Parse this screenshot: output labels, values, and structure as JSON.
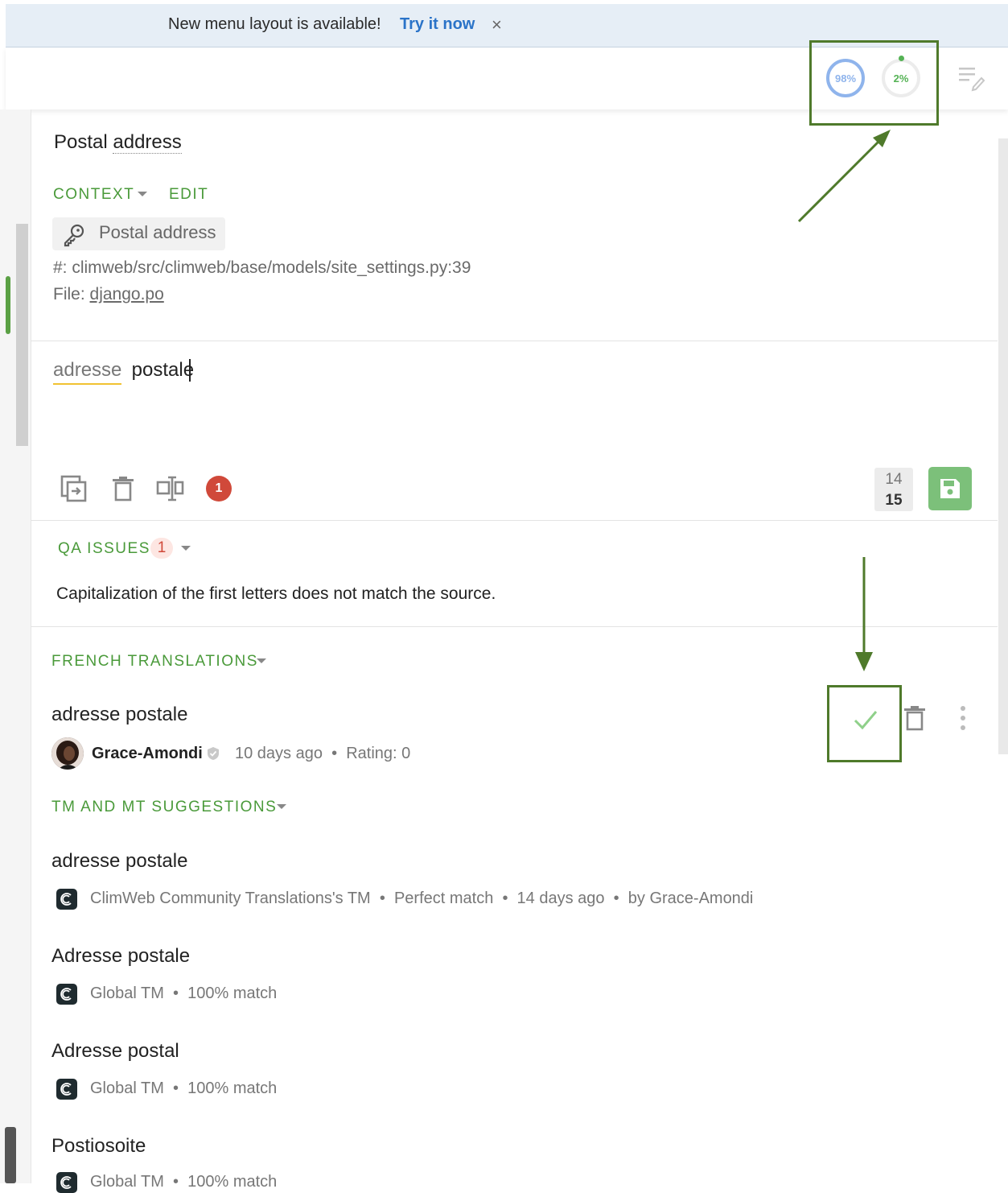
{
  "banner": {
    "text": "New menu layout is available!",
    "link": "Try it now",
    "close": "×"
  },
  "progress": {
    "approved_pct_label": "98%",
    "approved_fraction": 0.98,
    "pending_pct_label": "2%",
    "pending_fraction": 0.02
  },
  "colors": {
    "accent_green": "#4a9a3a",
    "approved_blue": "#8fb4ec",
    "warning_red": "#d0493a",
    "save_green": "#7cc07a",
    "highlight_box": "#4f7a2b"
  },
  "source": {
    "title_prefix": "Postal ",
    "title_underlined": "address",
    "context_label": "CONTEXT",
    "edit_label": "EDIT",
    "key": "Postal address",
    "path": "#: climweb/src/climweb/base/models/site_settings.py:39",
    "file_prefix": "File: ",
    "file_name": "django.po"
  },
  "editor": {
    "word1": "adresse",
    "word2": " postale",
    "warning_count": "1",
    "original_count": "14",
    "translation_count": "15"
  },
  "qa": {
    "label": "QA ISSUES",
    "count": "1",
    "message": "Capitalization of the first letters does not match the source."
  },
  "french": {
    "label": "FRENCH TRANSLATIONS",
    "text": "adresse postale",
    "author": "Grace-Amondi",
    "meta": "10 days ago  •  Rating: 0"
  },
  "suggestions": {
    "label": "TM AND MT SUGGESTIONS",
    "items": [
      {
        "text": "adresse postale",
        "meta": "ClimWeb Community Translations's TM  •  Perfect match  •  14 days ago  •  by Grace-Amondi"
      },
      {
        "text": "Adresse postale",
        "meta": "Global TM  •  100% match"
      },
      {
        "text": "Adresse postal",
        "meta": "Global TM  •  100% match"
      },
      {
        "text": "Postiosoite",
        "meta": "Global TM  •  100% match"
      }
    ]
  },
  "icons": [
    "close-icon",
    "edit-list-icon",
    "key-icon",
    "copy-icon",
    "trash-icon",
    "rotate-icon",
    "save-icon",
    "check-icon",
    "more-vertical-icon",
    "shield-check-icon",
    "tm-logo-icon",
    "arrow-annotation"
  ]
}
